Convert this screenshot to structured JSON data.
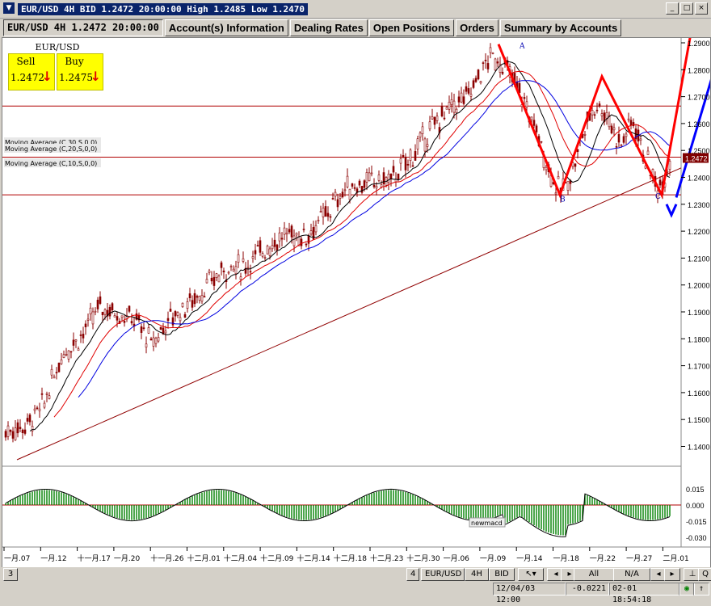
{
  "window": {
    "title": "EUR/USD 4H BID 1.2472 20:00:00 High 1.2485 Low 1.2470",
    "icon": "v-logo-icon"
  },
  "tabs": [
    {
      "label": "EUR/USD 4H 1.2472 20:00:00",
      "active": true
    },
    {
      "label": "Account(s) Information"
    },
    {
      "label": "Dealing Rates"
    },
    {
      "label": "Open Positions"
    },
    {
      "label": "Orders"
    },
    {
      "label": "Summary by Accounts"
    }
  ],
  "quote": {
    "symbol": "EUR/USD",
    "sell_label": "Sell",
    "sell_value": "1.2472",
    "buy_label": "Buy",
    "buy_value": "1.2475"
  },
  "chart": {
    "current_price": "1.2472",
    "indicators": [
      "Moving Average (C,30,S,0,0)",
      "Moving Average (C,20,S,0,0)",
      "Moving Average (C,10,S,0,0)"
    ],
    "pattern_labels": [
      "A",
      "B",
      "C"
    ],
    "macd_label": "newmacd",
    "price_ticks": [
      "1.2900",
      "1.2800",
      "1.2700",
      "1.2600",
      "1.2500",
      "1.2400",
      "1.2300",
      "1.2200",
      "1.2100",
      "1.2000",
      "1.1900",
      "1.1800",
      "1.1700",
      "1.1600",
      "1.1500",
      "1.1400"
    ],
    "macd_ticks": [
      "0.015",
      "0.000",
      "-0.015",
      "-0.030"
    ],
    "date_ticks": [
      "一月.07",
      "一月.12",
      "十一月.17",
      "一月.20",
      "十一月.26",
      "十二月.01",
      "十二月.04",
      "十二月.09",
      "十二月.14",
      "十二月.18",
      "十二月.23",
      "十二月.30",
      "一月.06",
      "一月.09",
      "一月.14",
      "一月.18",
      "一月.22",
      "一月.27",
      "二月.01"
    ],
    "colors": {
      "candle": "#8b0000",
      "ma10": "#000000",
      "ma20": "#e00000",
      "ma30": "#0000e0",
      "zigzag": "#ff0000",
      "projection": "#0000ff",
      "macd_bar": "#008000"
    }
  },
  "status": {
    "page": "3",
    "btn_4": "4",
    "symbol": "EUR/USD",
    "period": "4H",
    "price_type": "BID",
    "all": "All",
    "na": "N/A",
    "date_time": "12/04/03 12:00",
    "value": "-0.0221",
    "clock": "02-01  18:54:18"
  }
}
